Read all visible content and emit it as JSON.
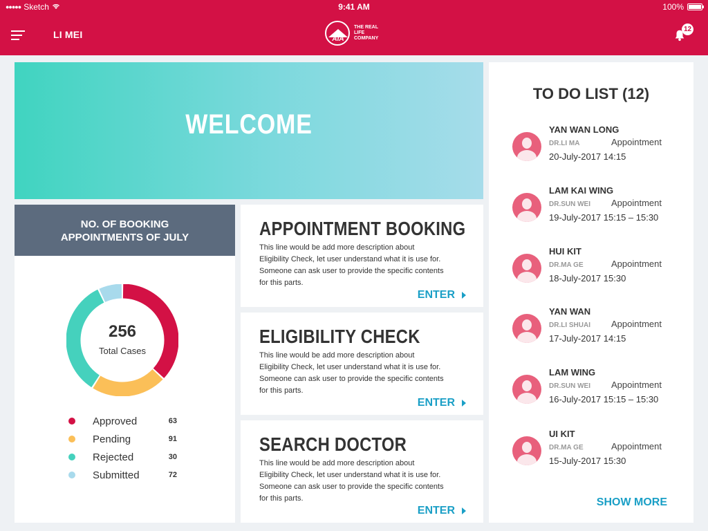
{
  "status_bar": {
    "carrier": "Sketch",
    "time": "9:41 AM",
    "battery": "100%"
  },
  "header": {
    "user": "LI MEI",
    "logo_text": "AIA",
    "tagline": "THE REAL LIFE COMPANY",
    "notification_count": "12",
    "bg_color": "#d31145"
  },
  "welcome": {
    "title": "WELCOME"
  },
  "bookings": {
    "title_line1": "NO. OF BOOKING",
    "title_line2": "APPOINTMENTS OF JULY",
    "total": "256",
    "total_label": "Total Cases",
    "legend": [
      {
        "name": "Approved",
        "count": "63",
        "color": "#d31145"
      },
      {
        "name": "Pending",
        "count": "91",
        "color": "#fbbf58"
      },
      {
        "name": "Rejected",
        "count": "30",
        "color": "#45d1bd"
      },
      {
        "name": "Submitted",
        "count": "72",
        "color": "#a8daec"
      }
    ]
  },
  "chart_data": {
    "type": "pie",
    "categories": [
      "Approved",
      "Pending",
      "Rejected",
      "Submitted"
    ],
    "values": [
      63,
      91,
      30,
      72
    ],
    "display_fractions": [
      0.37,
      0.22,
      0.34,
      0.07
    ],
    "colors": [
      "#d31145",
      "#fbbf58",
      "#45d1bd",
      "#a8daec"
    ],
    "title": "NO. OF BOOKING APPOINTMENTS OF JULY"
  },
  "cards": [
    {
      "title": "APPOINTMENT BOOKING",
      "description": "This line would be add more description about Eligibility Check, let user understand what it is use for. Someone can ask user to provide the specific contents for this parts.",
      "action": "ENTER"
    },
    {
      "title": "ELIGIBILITY CHECK",
      "description": "This line would be add more description about Eligibility Check, let user understand what it is use for. Someone can ask user to provide the specific contents for this parts.",
      "action": "ENTER"
    },
    {
      "title": "SEARCH DOCTOR",
      "description": "This line would be add more description about Eligibility Check, let user understand what it is use for. Someone can ask user to provide the specific contents for this parts.",
      "action": "ENTER"
    }
  ],
  "todo": {
    "title": "TO DO LIST (12)",
    "show_more": "SHOW MORE",
    "items": [
      {
        "name": "YAN WAN LONG",
        "doctor": "DR.LI MA",
        "type": "Appointment",
        "date": "20-July-2017  14:15"
      },
      {
        "name": "LAM KAI WING",
        "doctor": "DR.SUN WEI",
        "type": "Appointment",
        "date": "19-July-2017  15:15 – 15:30"
      },
      {
        "name": "HUI KIT",
        "doctor": "DR.MA GE",
        "type": "Appointment",
        "date": "18-July-2017  15:30"
      },
      {
        "name": "YAN WAN",
        "doctor": "DR.LI SHUAI",
        "type": "Appointment",
        "date": "17-July-2017  14:15"
      },
      {
        "name": "LAM WING",
        "doctor": "DR.SUN WEI",
        "type": "Appointment",
        "date": "16-July-2017  15:15 – 15:30"
      },
      {
        "name": "UI KIT",
        "doctor": "DR.MA GE",
        "type": "Appointment",
        "date": "15-July-2017  15:30"
      }
    ]
  }
}
